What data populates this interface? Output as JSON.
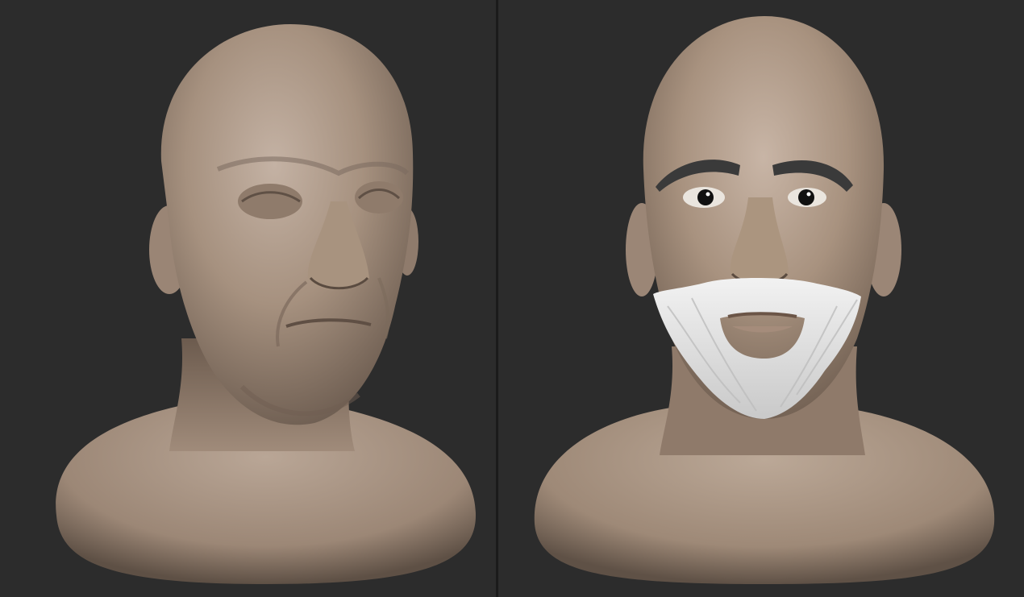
{
  "scene": {
    "background_color": "#2c2c2c",
    "divider_color": "#1b1b1b",
    "clay_color": "#a48f80",
    "hair_color": "#e9e9e9"
  },
  "panels": [
    {
      "content": "sculpted-bust-untextured"
    },
    {
      "content": "sculpted-bust-with-eyes-brows-beard"
    }
  ]
}
